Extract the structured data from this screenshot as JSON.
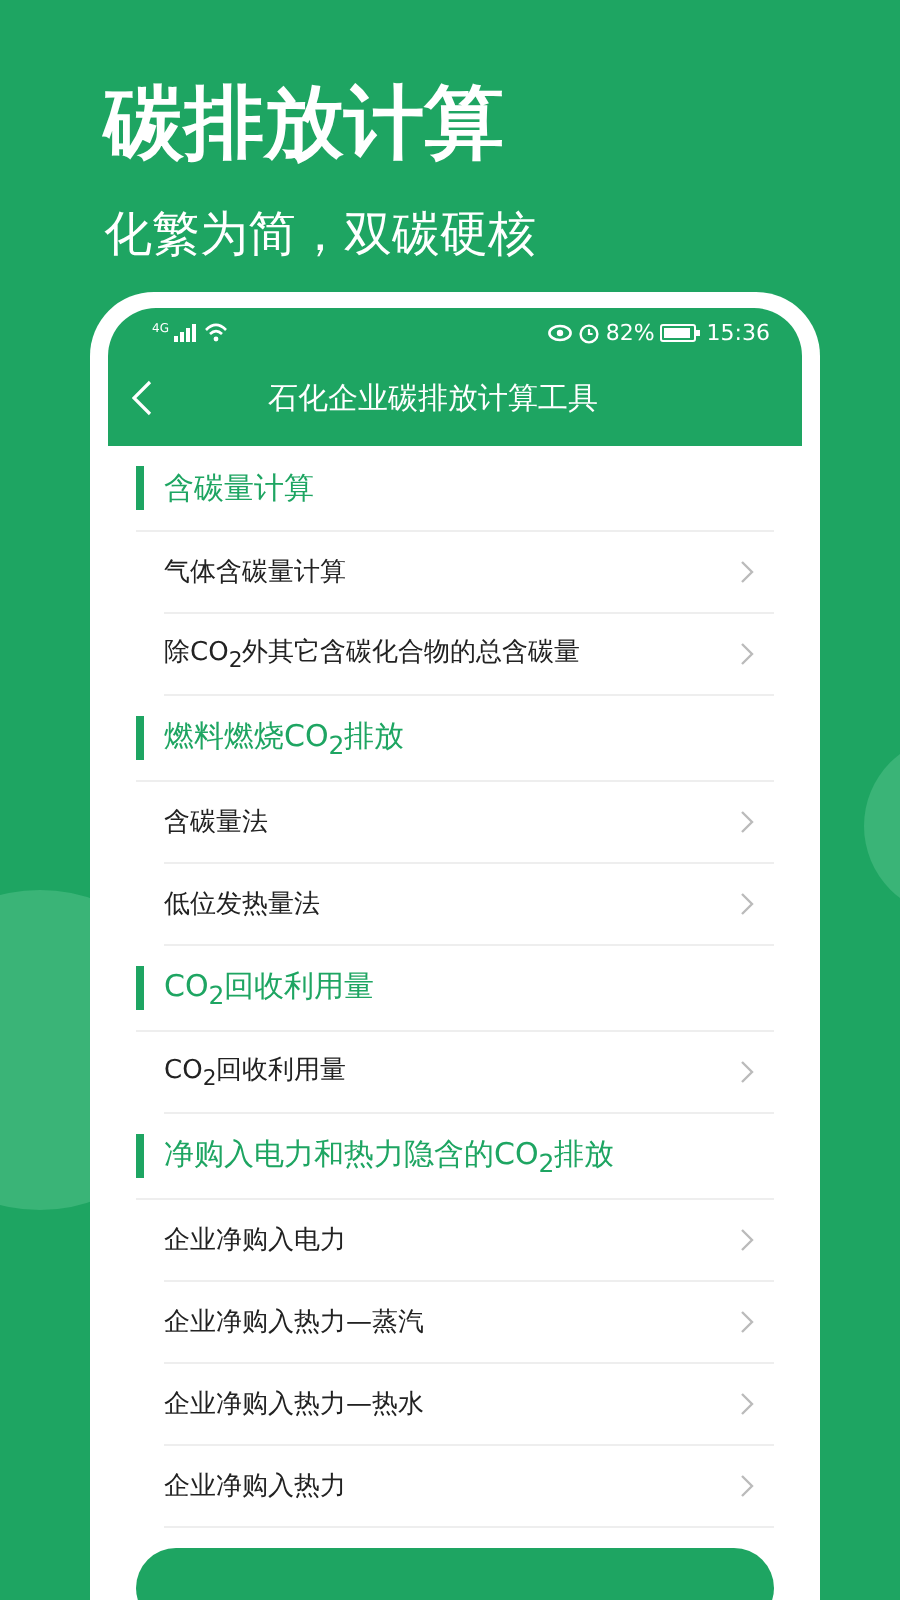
{
  "headline": "碳排放计算",
  "tagline": "化繁为简，双碳硬核",
  "status_bar": {
    "network": "4G",
    "battery": "82%",
    "time": "15:36"
  },
  "app_bar": {
    "title": "石化企业碳排放计算工具"
  },
  "sections": [
    {
      "title": "含碳量计算",
      "items": [
        {
          "label": "气体含碳量计算"
        },
        {
          "label": "除CO$_{2}$外其它含碳化合物的总含碳量"
        }
      ]
    },
    {
      "title": "燃料燃烧CO$_{2}$排放",
      "items": [
        {
          "label": "含碳量法"
        },
        {
          "label": "低位发热量法"
        }
      ]
    },
    {
      "title": "CO$_{2}$回收利用量",
      "items": [
        {
          "label": "CO$_{2}$回收利用量"
        }
      ]
    },
    {
      "title": "净购入电力和热力隐含的CO$_{2}$排放",
      "items": [
        {
          "label": "企业净购入电力"
        },
        {
          "label": "企业净购入热力—蒸汽"
        },
        {
          "label": "企业净购入热力—热水"
        },
        {
          "label": "企业净购入热力"
        }
      ]
    }
  ]
}
